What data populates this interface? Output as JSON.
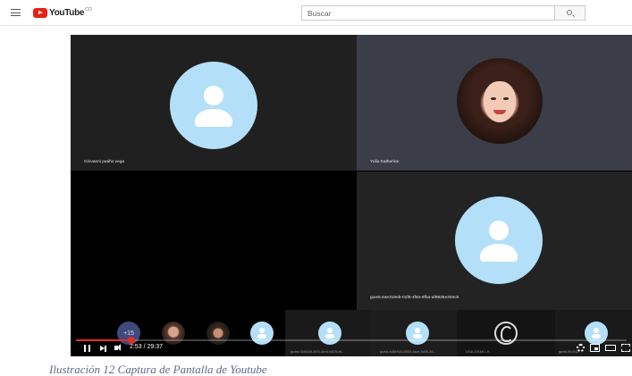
{
  "header": {
    "logo_text": "YouTube",
    "region": "CO",
    "search_placeholder": "Buscar"
  },
  "tiles": [
    {
      "name": "Giovanni patiño vega",
      "avatar": "person-icon"
    },
    {
      "name": "Yulia Katherine",
      "avatar": "profile-photo"
    },
    {
      "name": "",
      "avatar": "none"
    },
    {
      "name": "guest.64e319eb-01f8-4f84-8fba-af9826e304c9",
      "avatar": "person-icon"
    }
  ],
  "strip": {
    "more_count": "+15",
    "labels": [
      "guest.f1b6d3d-8f70-4ec4-b878-e6...",
      "guest.ed8e944-6550-4ace-9c55-30...",
      "UGA-10166 L.K.",
      "guest.f0c7b2..."
    ]
  },
  "player": {
    "progress": 0.1,
    "time_current": "2:53",
    "time_total": "29:37",
    "time_separator": " / ",
    "accent_color": "#e52d27"
  },
  "caption": "Ilustración 12 Captura de Pantalla de Youtube"
}
